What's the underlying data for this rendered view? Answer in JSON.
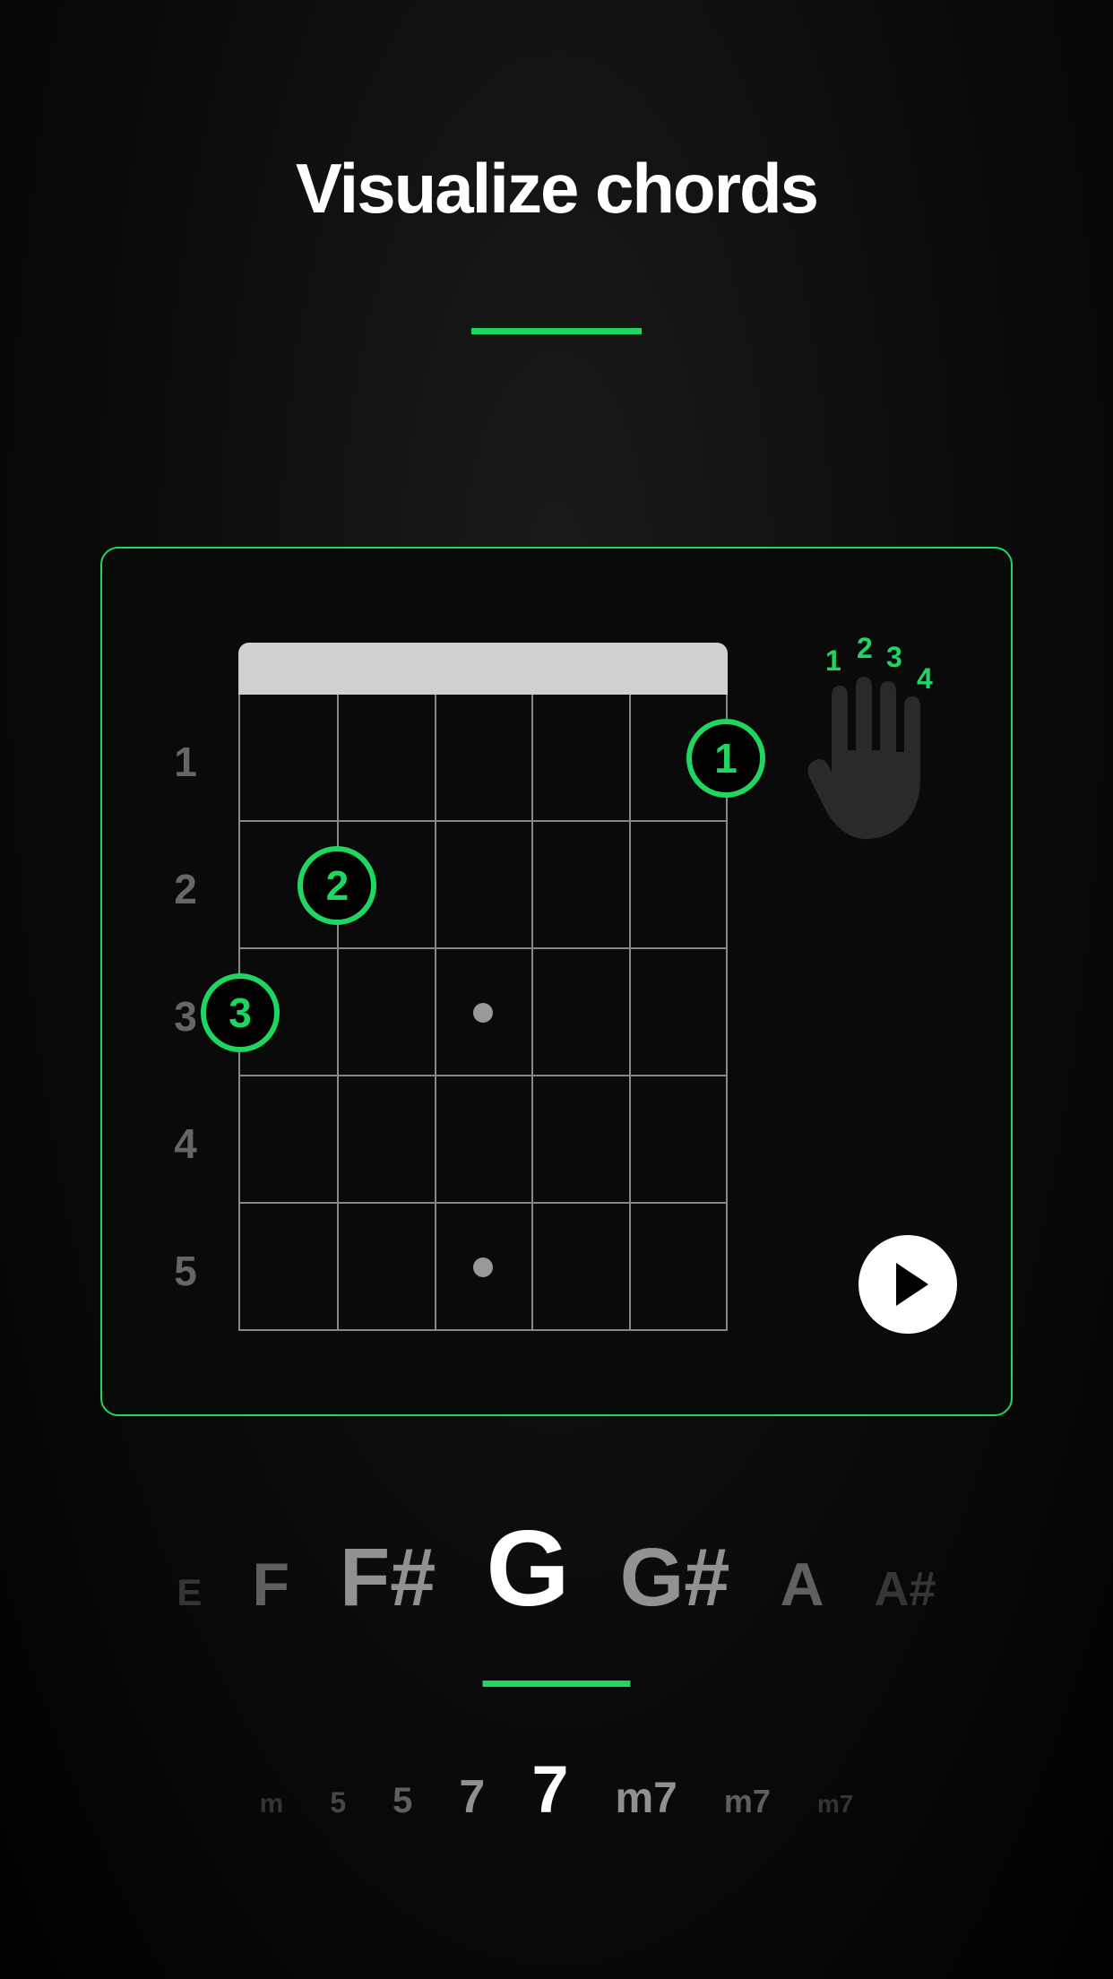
{
  "title": "Visualize chords",
  "fret_numbers": [
    "1",
    "2",
    "3",
    "4",
    "5"
  ],
  "finger_positions": [
    {
      "finger": "1",
      "fret": 1,
      "string": 6
    },
    {
      "finger": "2",
      "fret": 2,
      "string": 2
    },
    {
      "finger": "3",
      "fret": 3,
      "string": 1
    }
  ],
  "hand_fingers": [
    "1",
    "2",
    "3",
    "4"
  ],
  "root_notes": [
    {
      "label": "E",
      "size": 42,
      "opacity": 0.18
    },
    {
      "label": "F",
      "size": 68,
      "opacity": 0.35
    },
    {
      "label": "F#",
      "size": 92,
      "opacity": 0.55
    },
    {
      "label": "G",
      "size": 120,
      "opacity": 1.0
    },
    {
      "label": "G#",
      "size": 92,
      "opacity": 0.55
    },
    {
      "label": "A",
      "size": 68,
      "opacity": 0.35
    },
    {
      "label": "A#",
      "size": 54,
      "opacity": 0.18
    }
  ],
  "chord_types": [
    {
      "label": "m",
      "size": 30,
      "opacity": 0.18
    },
    {
      "label": "5",
      "size": 32,
      "opacity": 0.25
    },
    {
      "label": "5",
      "size": 40,
      "opacity": 0.35
    },
    {
      "label": "7",
      "size": 52,
      "opacity": 0.55
    },
    {
      "label": "7",
      "size": 74,
      "opacity": 1.0
    },
    {
      "label": "m7",
      "size": 48,
      "opacity": 0.55
    },
    {
      "label": "m7",
      "size": 36,
      "opacity": 0.35
    },
    {
      "label": "m7",
      "size": 28,
      "opacity": 0.18
    }
  ],
  "colors": {
    "accent": "#1ed760"
  }
}
